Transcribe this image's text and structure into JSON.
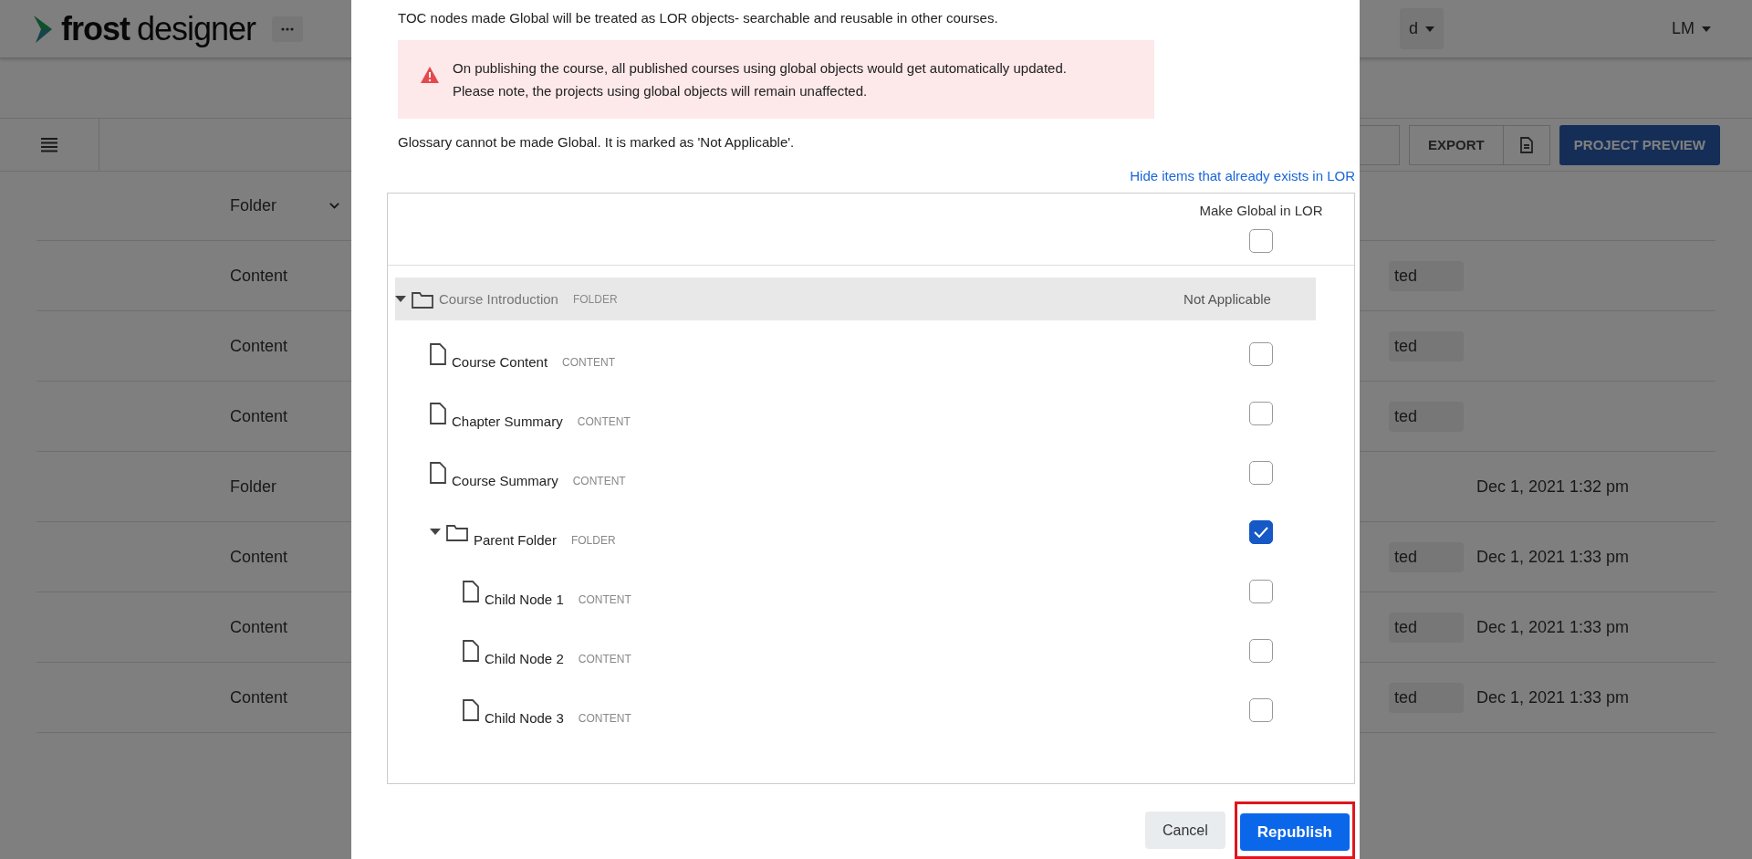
{
  "header": {
    "logo_bold": "frost",
    "logo_light": "designer",
    "project_menu": "d",
    "user_menu": "LM"
  },
  "toolbar": {
    "export_button": "EXPORT",
    "preview_button": "PROJECT PREVIEW"
  },
  "table": {
    "type_filter": "Folder",
    "rows": [
      {
        "type": "Content",
        "badge": "ted"
      },
      {
        "type": "Content",
        "badge": "ted"
      },
      {
        "type": "Content",
        "badge": "ted"
      },
      {
        "type": "Folder",
        "date": "Dec 1, 2021 1:32 pm"
      },
      {
        "type": "Content",
        "badge": "ted",
        "date": "Dec 1, 2021 1:33 pm"
      },
      {
        "type": "Content",
        "badge": "ted",
        "date": "Dec 1, 2021 1:33 pm"
      },
      {
        "type": "Content",
        "badge": "ted",
        "date": "Dec 1, 2021 1:33 pm"
      }
    ]
  },
  "dialog": {
    "intro": "TOC nodes made Global will be treated as LOR objects- searchable and reusable in other courses.",
    "alert": [
      "On publishing the course, all published courses using global objects would get automatically updated.",
      "Please note, the projects using global objects will remain unaffected."
    ],
    "note": "Glossary cannot be made Global. It is marked as 'Not Applicable'.",
    "hide_link": "Hide items that already exists in LOR",
    "tree": {
      "column": "Make Global in LOR",
      "all_checked": false,
      "nodes": [
        {
          "kind": "folder",
          "name": "Course Introduction",
          "type": "FOLDER",
          "expanded": true,
          "disabled": true,
          "status": "Not Applicable",
          "children": [
            {
              "kind": "file",
              "name": "Course Content",
              "type": "CONTENT",
              "disabled": false,
              "checked": false
            },
            {
              "kind": "file",
              "name": "Chapter Summary",
              "type": "CONTENT",
              "disabled": false,
              "checked": false
            },
            {
              "kind": "file",
              "name": "Course Summary",
              "type": "CONTENT",
              "disabled": false,
              "checked": false
            },
            {
              "kind": "folder",
              "name": "Parent Folder",
              "type": "FOLDER",
              "expanded": true,
              "disabled": false,
              "checked": true,
              "children": [
                {
                  "kind": "file",
                  "name": "Child Node 1",
                  "type": "CONTENT",
                  "disabled": false,
                  "checked": false
                },
                {
                  "kind": "file",
                  "name": "Child Node 2",
                  "type": "CONTENT",
                  "disabled": false,
                  "checked": false
                },
                {
                  "kind": "file",
                  "name": "Child Node 3",
                  "type": "CONTENT",
                  "disabled": false,
                  "checked": false
                }
              ]
            }
          ]
        }
      ]
    },
    "cancel_button": "Cancel",
    "republish_button": "Republish",
    "republish_highlighted": true
  }
}
